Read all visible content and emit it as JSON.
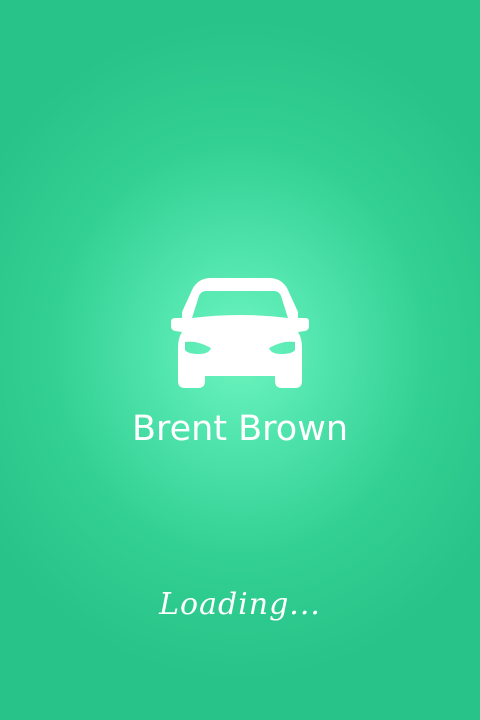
{
  "splash": {
    "app_name": "Brent Brown",
    "loading_text": "Loading...",
    "logo_icon": "car-front-icon"
  },
  "colors": {
    "background_edge": "#27c389",
    "background_center": "#6ef5c0",
    "foreground": "#ffffff"
  }
}
